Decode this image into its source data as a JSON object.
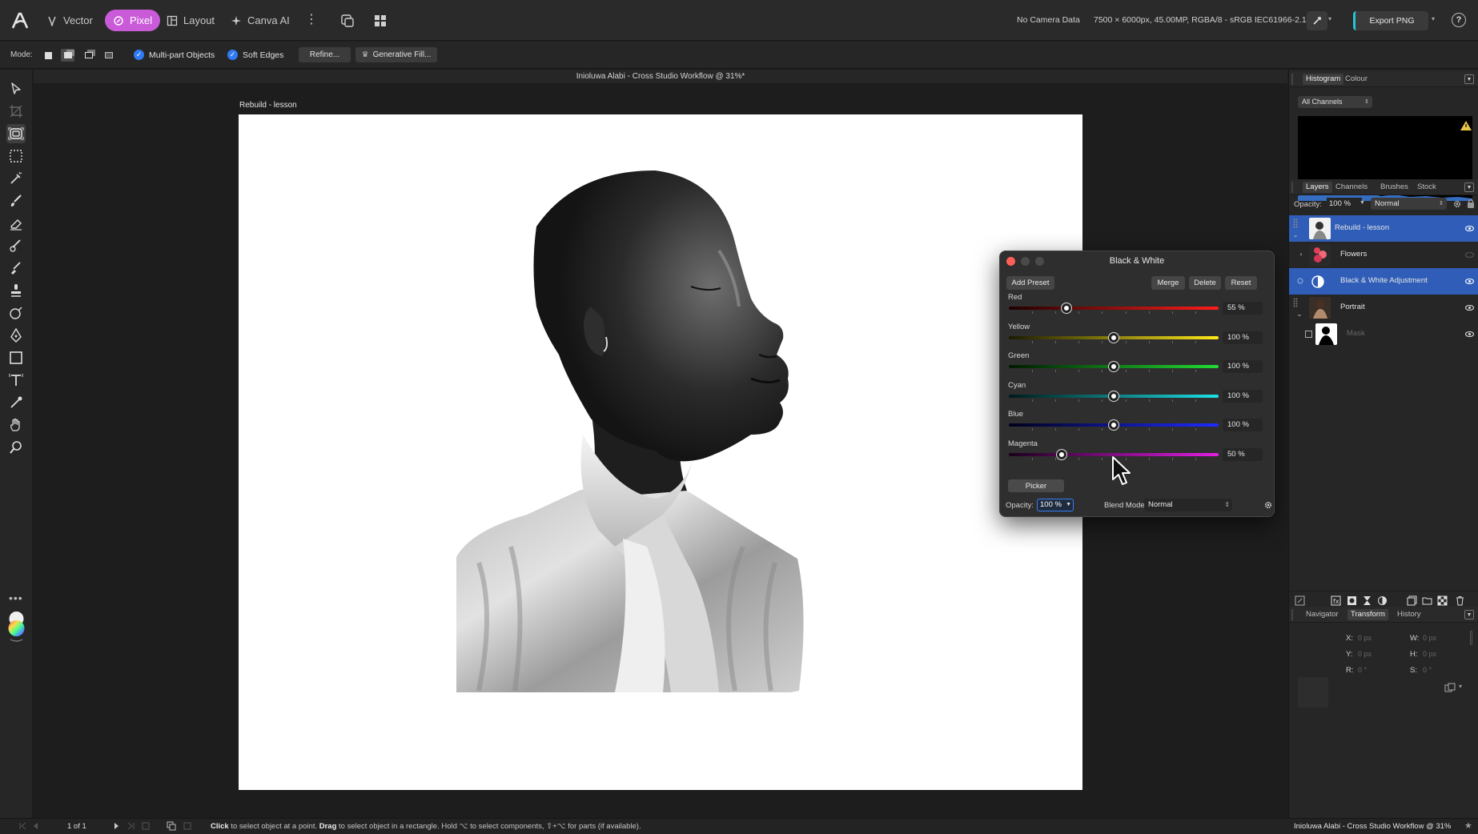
{
  "app": {
    "personas": [
      "Vector",
      "Pixel",
      "Layout",
      "Canva AI"
    ],
    "active_persona": "Pixel",
    "camera_info": "No Camera Data",
    "doc_info": "7500 × 6000px, 45.00MP, RGBA/8 - sRGB IEC61966-2.1",
    "export_label": "Export PNG",
    "accent": "#c95ad8"
  },
  "context": {
    "mode_label": "Mode:",
    "multipart_label": "Multi-part Objects",
    "softedges_label": "Soft Edges",
    "refine_label": "Refine...",
    "genfill_label": "Generative Fill..."
  },
  "document": {
    "window_title": "Inioluwa Alabi - Cross Studio Workflow @ 31%*",
    "artboard_label": "Rebuild - lesson"
  },
  "bw_dialog": {
    "title": "Black & White",
    "add_preset": "Add Preset",
    "merge": "Merge",
    "delete": "Delete",
    "reset": "Reset",
    "sliders": [
      {
        "label": "Red",
        "value": 55,
        "display": "55 %",
        "from": "#200000",
        "to": "#ff1c1c"
      },
      {
        "label": "Yellow",
        "value": 100,
        "display": "100 %",
        "from": "#1a1a00",
        "to": "#ffe81a"
      },
      {
        "label": "Green",
        "value": 100,
        "display": "100 %",
        "from": "#001a00",
        "to": "#22dd33"
      },
      {
        "label": "Cyan",
        "value": 100,
        "display": "100 %",
        "from": "#001a1a",
        "to": "#1ce0e6"
      },
      {
        "label": "Blue",
        "value": 100,
        "display": "100 %",
        "from": "#00001a",
        "to": "#1d2bff"
      },
      {
        "label": "Magenta",
        "value": 50,
        "display": "50 %",
        "from": "#1a001a",
        "to": "#e51de6"
      }
    ],
    "picker": "Picker",
    "opacity_label": "Opacity:",
    "opacity_value": "100 %",
    "blend_label": "Blend Mode:",
    "blend_value": "Normal"
  },
  "panels": {
    "histogram_tabs": [
      "Histogram",
      "Colour"
    ],
    "channels_select": "All Channels",
    "layers_tabs": [
      "Layers",
      "Channels",
      "Brushes",
      "Stock"
    ],
    "layers_opacity_label": "Opacity:",
    "layers_opacity_value": "100 %",
    "layers_blend": "Normal",
    "layers": [
      {
        "name": "Rebuild - lesson",
        "selected": true
      },
      {
        "name": "Flowers",
        "selected": false
      },
      {
        "name": "Black & White Adjustment",
        "selected": true
      },
      {
        "name": "Portrait",
        "selected": false
      },
      {
        "name": "Mask",
        "selected": false
      }
    ],
    "bottom_tabs": [
      "Navigator",
      "Transform",
      "History"
    ],
    "transform": {
      "x_label": "X:",
      "x_val": "0 px",
      "y_label": "Y:",
      "y_val": "0 px",
      "w_label": "W:",
      "w_val": "0 px",
      "h_label": "H:",
      "h_val": "0 px",
      "r_label": "R:",
      "r_val": "0 °",
      "s_label": "S:",
      "s_val": "0 °"
    }
  },
  "status": {
    "page": "1 of 1",
    "hint_click": "Click",
    "hint_1": " to select object at a point. ",
    "hint_drag": "Drag",
    "hint_2": " to select object in a rectangle. Hold ⌥ to select components, ⇧+⌥ for parts (if available).",
    "doc": "Inioluwa Alabi - Cross Studio Workflow @ 31%"
  }
}
